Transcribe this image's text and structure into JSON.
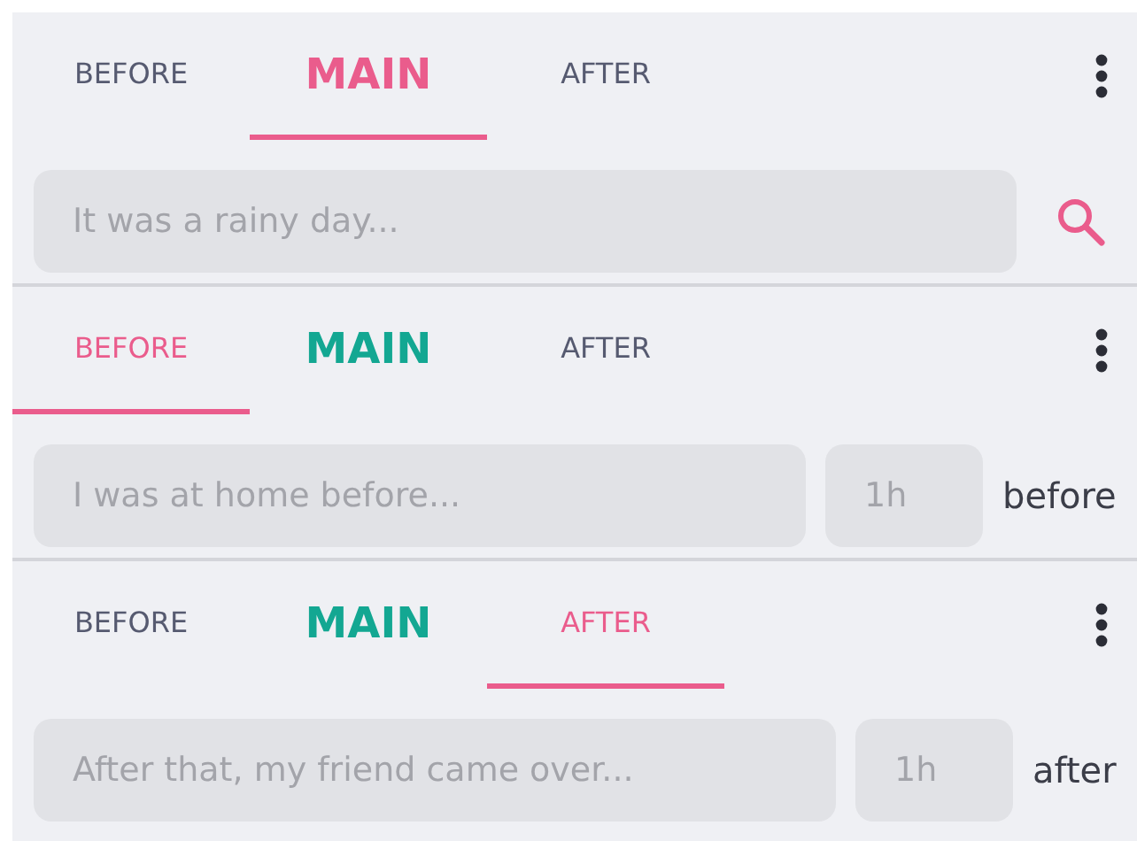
{
  "panels": [
    {
      "kind": "search",
      "tabs": [
        {
          "label": "BEFORE",
          "kind": "side",
          "selected": false
        },
        {
          "label": "MAIN",
          "kind": "main",
          "selected": true
        },
        {
          "label": "AFTER",
          "kind": "side",
          "selected": false
        }
      ],
      "input": {
        "placeholder": "It was a rainy day..."
      }
    },
    {
      "kind": "timed",
      "tabs": [
        {
          "label": "BEFORE",
          "kind": "side",
          "selected": true
        },
        {
          "label": "MAIN",
          "kind": "main",
          "selected": false
        },
        {
          "label": "AFTER",
          "kind": "side",
          "selected": false
        }
      ],
      "input": {
        "placeholder": "I was at home before..."
      },
      "duration": {
        "placeholder": "1h"
      },
      "relation": "before"
    },
    {
      "kind": "timed",
      "tabs": [
        {
          "label": "BEFORE",
          "kind": "side",
          "selected": false
        },
        {
          "label": "MAIN",
          "kind": "main",
          "selected": false
        },
        {
          "label": "AFTER",
          "kind": "side",
          "selected": true
        }
      ],
      "input": {
        "placeholder": "After that, my friend came over..."
      },
      "duration": {
        "placeholder": "1h"
      },
      "relation": "after"
    }
  ]
}
